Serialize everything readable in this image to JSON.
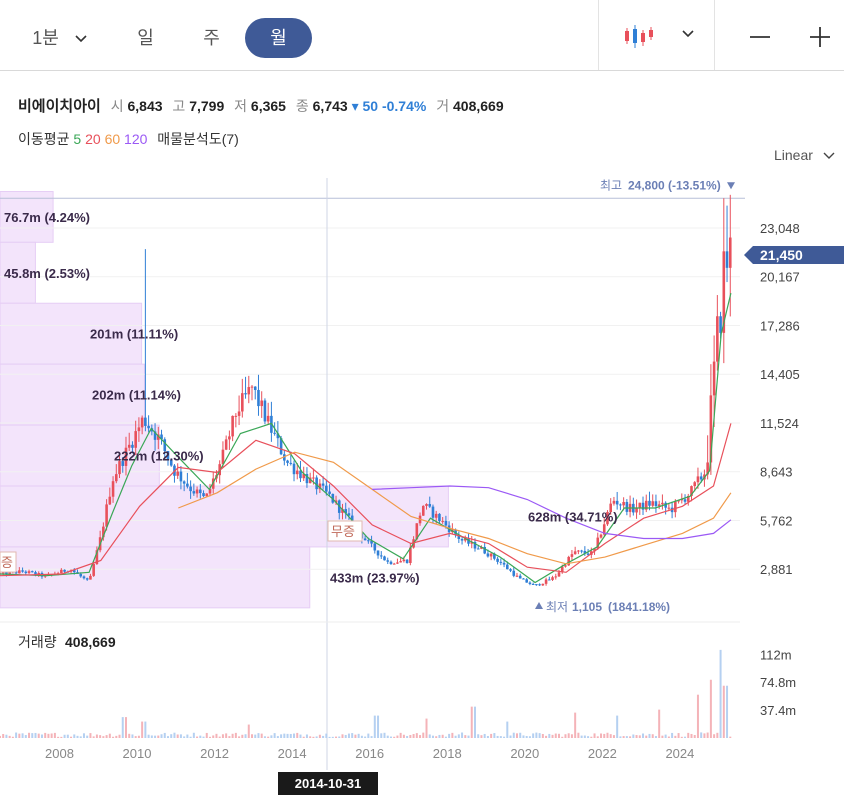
{
  "tabs": [
    {
      "label": "1분",
      "active": false
    },
    {
      "label": "일",
      "active": false
    },
    {
      "label": "주",
      "active": false
    },
    {
      "label": "월",
      "active": true
    }
  ],
  "toolbar": {
    "chart_type_icon": "candlestick-icon",
    "dropdown_icon": "chevron-down-icon",
    "minimize_icon": "minus-icon",
    "add_icon": "plus-icon"
  },
  "stock": {
    "name": "비에이치아이",
    "open_label": "시",
    "open": "6,843",
    "high_label": "고",
    "high": "7,799",
    "low_label": "저",
    "low": "6,365",
    "close_label": "종",
    "close": "6,743",
    "change": "▾ 50",
    "change_pct": "-0.74%",
    "volume_label": "거",
    "volume": "408,669"
  },
  "ma": {
    "label": "이동평균",
    "periods": [
      "5",
      "20",
      "60",
      "120"
    ],
    "colors": [
      "#3aa757",
      "#e8505b",
      "#f09a4a",
      "#9b59f5"
    ],
    "profile_label": "매물분석도(7)"
  },
  "scale": {
    "label": "Linear"
  },
  "volume_panel": {
    "label": "거래량",
    "value": "408,669"
  },
  "crosshair_date": "2014-10-31",
  "colors": {
    "up": "#e8505b",
    "down": "#2f7fd6",
    "current_price_bg": "#3f5a97",
    "profile": "#f3e4fb",
    "profile_border": "#e6cdf5",
    "accent": "#3f5a97"
  },
  "chart_data": {
    "type": "candlestick",
    "title": "",
    "ylim": [
      0,
      26000
    ],
    "y_ticks": [
      2881,
      5762,
      8643,
      11524,
      14405,
      17286,
      20167,
      23048
    ],
    "y_tick_labels": [
      "2,881",
      "5,762",
      "8,643",
      "11,524",
      "14,405",
      "17,286",
      "20,167",
      "23,048"
    ],
    "x_ticks": [
      2008,
      2010,
      2012,
      2014,
      2016,
      2018,
      2020,
      2022,
      2024
    ],
    "x_tick_labels": [
      "2008",
      "2010",
      "2012",
      "2014",
      "2016",
      "2018",
      "2020",
      "2022",
      "2024"
    ],
    "xlim": [
      2006.4,
      2025.4
    ],
    "current_price": 21450,
    "current_price_label": "21,450",
    "high_marker": {
      "value": 24800,
      "date": 2025.05,
      "label": "최고",
      "value_label": "24,800",
      "pct": "(-13.51%)"
    },
    "low_marker": {
      "value": 1105,
      "date": 2020.2,
      "label": "최저",
      "value_label": "1,105",
      "pct": "(1841.18%)"
    },
    "volume_profile": [
      {
        "price_low": 22200,
        "price_high": 25200,
        "ratio": 0.09,
        "label": "76.7m (4.24%)"
      },
      {
        "price_low": 18600,
        "price_high": 22200,
        "ratio": 0.06,
        "label": "45.8m (2.53%)"
      },
      {
        "price_low": 15000,
        "price_high": 18600,
        "ratio": 0.24,
        "label": "201m (11.11%)"
      },
      {
        "price_low": 11400,
        "price_high": 15000,
        "ratio": 0.245,
        "label": "202m (11.14%)"
      },
      {
        "price_low": 7800,
        "price_high": 11400,
        "ratio": 0.27,
        "label": "222m (12.30%)"
      },
      {
        "price_low": 4200,
        "price_high": 7800,
        "ratio": 0.76,
        "label": "628m (34.71%)"
      },
      {
        "price_low": 600,
        "price_high": 4200,
        "ratio": 0.525,
        "label": "433m (23.97%)"
      }
    ],
    "profile_tags": [
      "무증",
      "증"
    ],
    "anchors": [
      [
        2006.4,
        2600
      ],
      [
        2007.0,
        2750
      ],
      [
        2007.6,
        2450
      ],
      [
        2008.2,
        2900
      ],
      [
        2008.7,
        2100
      ],
      [
        2009.0,
        4800
      ],
      [
        2009.3,
        8200
      ],
      [
        2009.7,
        10000
      ],
      [
        2010.1,
        11800
      ],
      [
        2010.5,
        10600
      ],
      [
        2010.9,
        8700
      ],
      [
        2011.3,
        7700
      ],
      [
        2011.7,
        7000
      ],
      [
        2012.1,
        9200
      ],
      [
        2012.5,
        12200
      ],
      [
        2012.9,
        13600
      ],
      [
        2013.3,
        11600
      ],
      [
        2013.8,
        9200
      ],
      [
        2014.4,
        8100
      ],
      [
        2014.9,
        7200
      ],
      [
        2015.4,
        5800
      ],
      [
        2015.9,
        4400
      ],
      [
        2016.4,
        3300
      ],
      [
        2016.9,
        3400
      ],
      [
        2017.3,
        6700
      ],
      [
        2017.8,
        5700
      ],
      [
        2018.3,
        4600
      ],
      [
        2018.8,
        4100
      ],
      [
        2019.3,
        3300
      ],
      [
        2019.8,
        2300
      ],
      [
        2020.2,
        1900
      ],
      [
        2020.7,
        2400
      ],
      [
        2021.2,
        3900
      ],
      [
        2021.7,
        3800
      ],
      [
        2022.2,
        7000
      ],
      [
        2022.7,
        6400
      ],
      [
        2023.2,
        6800
      ],
      [
        2023.7,
        6400
      ],
      [
        2024.2,
        7400
      ],
      [
        2024.6,
        8700
      ],
      [
        2024.9,
        16500
      ],
      [
        2025.1,
        21200
      ],
      [
        2025.25,
        21450
      ]
    ],
    "ma_lines": [
      {
        "name": "5",
        "color": "#3aa757",
        "points": [
          [
            2006.4,
            2600
          ],
          [
            2007.6,
            2500
          ],
          [
            2008.7,
            2700
          ],
          [
            2009.3,
            6200
          ],
          [
            2009.8,
            9000
          ],
          [
            2010.3,
            11200
          ],
          [
            2011.0,
            9500
          ],
          [
            2011.8,
            7600
          ],
          [
            2012.6,
            10900
          ],
          [
            2013.4,
            11500
          ],
          [
            2014.2,
            8600
          ],
          [
            2015.0,
            7000
          ],
          [
            2015.9,
            4700
          ],
          [
            2016.8,
            3500
          ],
          [
            2017.5,
            5900
          ],
          [
            2018.4,
            4700
          ],
          [
            2019.3,
            3600
          ],
          [
            2020.2,
            2100
          ],
          [
            2021.0,
            3200
          ],
          [
            2021.8,
            4200
          ],
          [
            2022.5,
            6500
          ],
          [
            2023.3,
            6500
          ],
          [
            2024.2,
            7200
          ],
          [
            2024.7,
            8700
          ],
          [
            2025.0,
            16800
          ],
          [
            2025.25,
            19200
          ]
        ]
      },
      {
        "name": "20",
        "color": "#e8505b",
        "points": [
          [
            2006.4,
            2500
          ],
          [
            2008.0,
            2600
          ],
          [
            2009.0,
            3400
          ],
          [
            2010.0,
            6600
          ],
          [
            2011.0,
            8900
          ],
          [
            2012.0,
            8600
          ],
          [
            2013.0,
            10500
          ],
          [
            2014.0,
            9700
          ],
          [
            2015.0,
            7800
          ],
          [
            2016.0,
            5500
          ],
          [
            2017.0,
            4400
          ],
          [
            2018.0,
            5000
          ],
          [
            2019.0,
            4400
          ],
          [
            2020.0,
            3000
          ],
          [
            2021.0,
            2700
          ],
          [
            2022.0,
            4400
          ],
          [
            2023.0,
            5900
          ],
          [
            2024.0,
            6600
          ],
          [
            2024.8,
            7800
          ],
          [
            2025.25,
            11500
          ]
        ]
      },
      {
        "name": "60",
        "color": "#f09a4a",
        "points": [
          [
            2011.0,
            6500
          ],
          [
            2012.0,
            7400
          ],
          [
            2013.0,
            8800
          ],
          [
            2014.0,
            9800
          ],
          [
            2015.0,
            9200
          ],
          [
            2016.0,
            7600
          ],
          [
            2017.0,
            6000
          ],
          [
            2018.0,
            5300
          ],
          [
            2019.0,
            4700
          ],
          [
            2020.0,
            3800
          ],
          [
            2021.0,
            3200
          ],
          [
            2022.0,
            3600
          ],
          [
            2023.0,
            4300
          ],
          [
            2024.0,
            5000
          ],
          [
            2024.8,
            5900
          ],
          [
            2025.25,
            7400
          ]
        ]
      },
      {
        "name": "120",
        "color": "#9b59f5",
        "points": [
          [
            2016.0,
            7600
          ],
          [
            2017.0,
            7700
          ],
          [
            2018.0,
            7800
          ],
          [
            2019.0,
            7700
          ],
          [
            2020.0,
            7000
          ],
          [
            2021.0,
            5900
          ],
          [
            2022.0,
            5000
          ],
          [
            2023.0,
            4700
          ],
          [
            2024.0,
            4700
          ],
          [
            2024.8,
            5000
          ],
          [
            2025.25,
            5800
          ]
        ]
      }
    ],
    "volume": {
      "y_ticks": [
        37400000,
        74800000,
        112000000
      ],
      "y_tick_labels": [
        "37.4m",
        "74.8m",
        "112m"
      ],
      "ylim": [
        0,
        150000000
      ],
      "spikes": [
        [
          2009.6,
          28000000
        ],
        [
          2010.1,
          22000000
        ],
        [
          2012.8,
          18000000
        ],
        [
          2016.1,
          30000000
        ],
        [
          2017.4,
          26000000
        ],
        [
          2018.6,
          42000000
        ],
        [
          2019.5,
          22000000
        ],
        [
          2021.2,
          34000000
        ],
        [
          2022.3,
          30000000
        ],
        [
          2023.4,
          38000000
        ],
        [
          2024.4,
          58000000
        ],
        [
          2024.7,
          78000000
        ],
        [
          2024.95,
          118000000
        ],
        [
          2025.1,
          70000000
        ]
      ]
    }
  }
}
